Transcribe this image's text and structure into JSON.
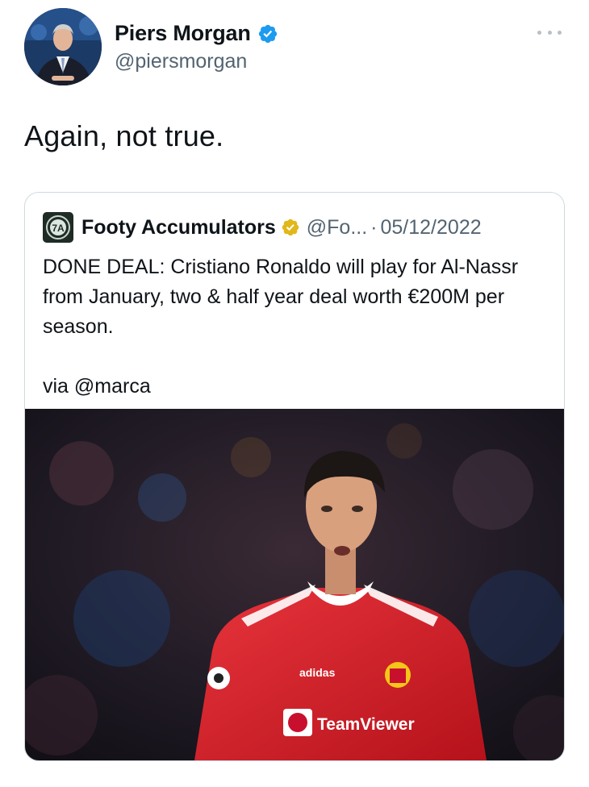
{
  "tweet": {
    "author": {
      "display_name": "Piers Morgan",
      "handle": "@piersmorgan",
      "verified": true
    },
    "more_icon": "more-horizontal-icon",
    "text": "Again, not true."
  },
  "quoted_tweet": {
    "author": {
      "display_name": "Footy Accumulators",
      "handle": "@Fo...",
      "verified": true,
      "verified_color": "#e2b719"
    },
    "separator": "·",
    "date": "05/12/2022",
    "body": "DONE DEAL: Cristiano Ronaldo will play for Al-Nassr from January, two & half year deal worth €200M per season.",
    "via": "via @marca",
    "media": {
      "sponsor_text": "TeamViewer",
      "kit_brand_text": "adidas"
    }
  },
  "colors": {
    "text_primary": "#0f1419",
    "text_secondary": "#536471",
    "verified_blue": "#1d9bf0",
    "border": "#cfd9de"
  }
}
